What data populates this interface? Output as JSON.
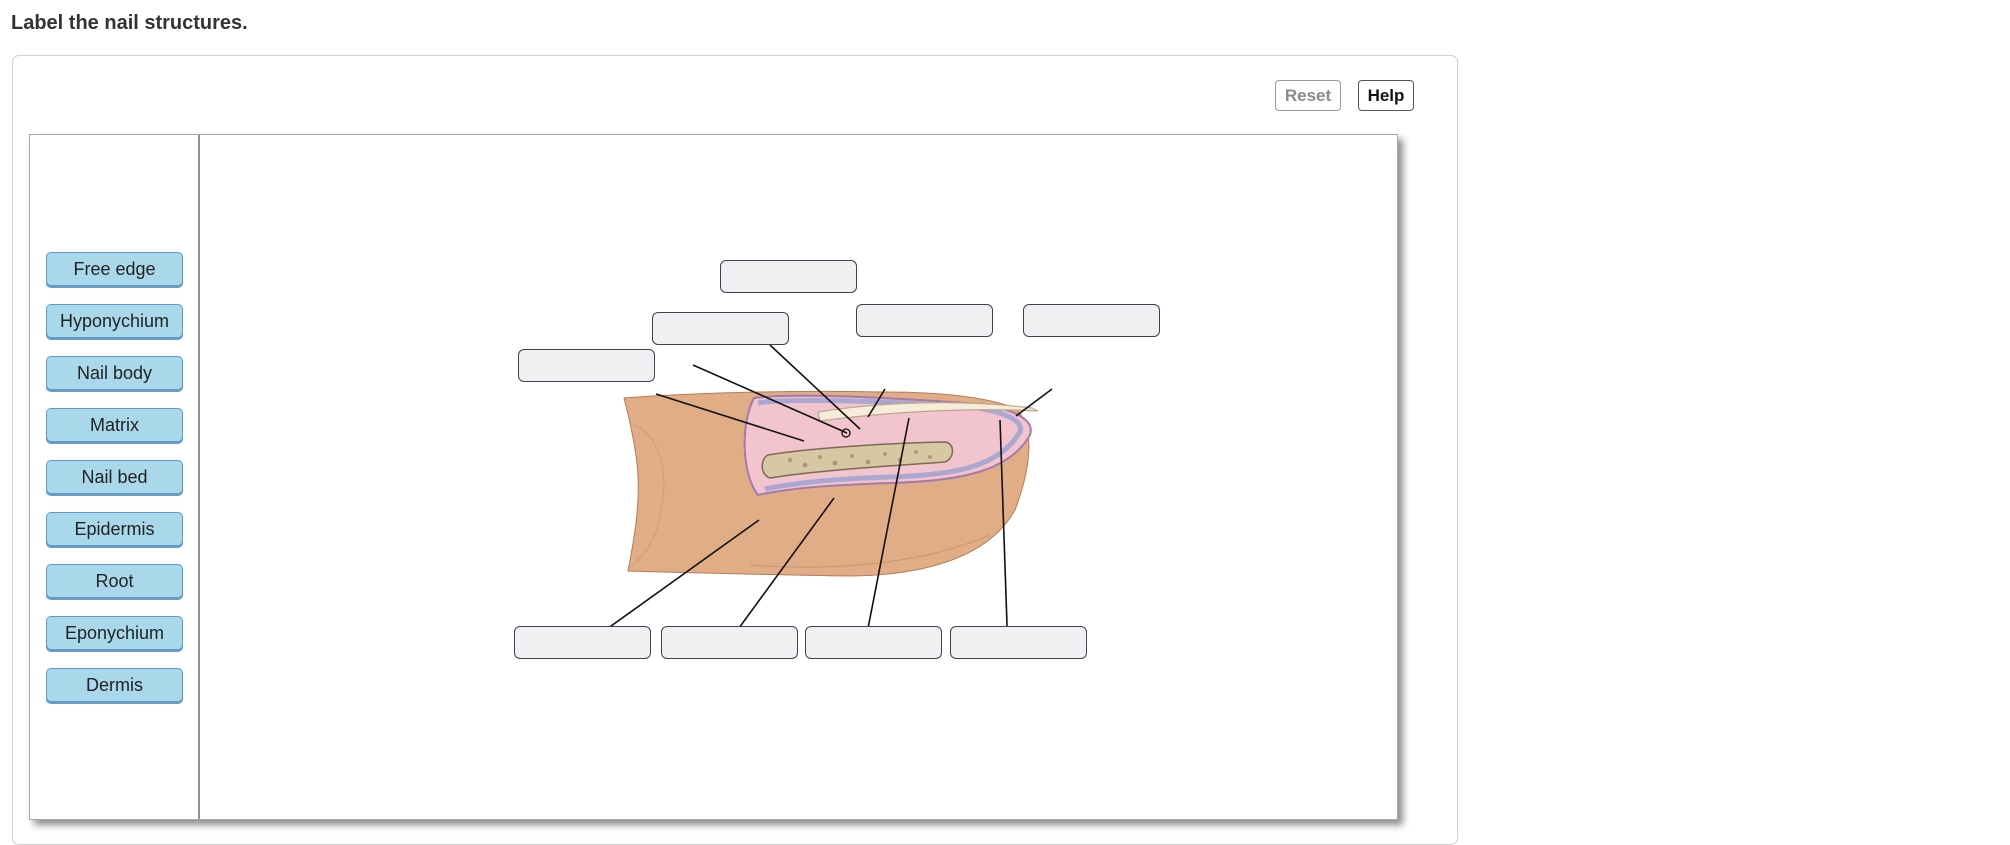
{
  "title": "Label the nail structures.",
  "toolbar": {
    "reset_label": "Reset",
    "help_label": "Help"
  },
  "labels": [
    "Free edge",
    "Hyponychium",
    "Nail body",
    "Matrix",
    "Nail bed",
    "Epidermis",
    "Root",
    "Eponychium",
    "Dermis"
  ],
  "drop_targets_count": 9,
  "colors": {
    "chip_bg": "#a8d8ea",
    "chip_border": "#5b9bc8",
    "drop_bg": "#eef0f2",
    "drop_border": "#3b4254"
  }
}
